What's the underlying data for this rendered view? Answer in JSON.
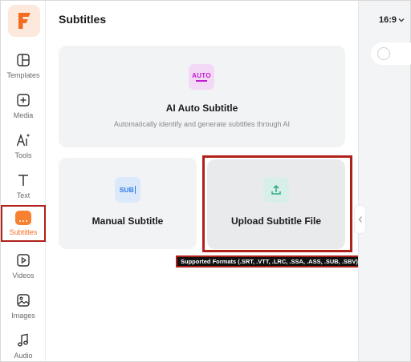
{
  "panel": {
    "title": "Subtitles"
  },
  "brand": {
    "logo_letter": "F",
    "accent_color": "#f26d21"
  },
  "nav": {
    "items": [
      {
        "label": "Templates",
        "icon": "templates-icon"
      },
      {
        "label": "Media",
        "icon": "media-plus-icon"
      },
      {
        "label": "Tools",
        "icon": "ai-tools-icon"
      },
      {
        "label": "Text",
        "icon": "text-icon"
      },
      {
        "label": "Subtitles",
        "icon": "subtitles-icon",
        "active": true
      },
      {
        "label": "Videos",
        "icon": "video-play-icon"
      },
      {
        "label": "Images",
        "icon": "image-icon"
      },
      {
        "label": "Audio",
        "icon": "music-note-icon"
      }
    ]
  },
  "cards": {
    "ai": {
      "icon_text": "AUTO",
      "title": "AI Auto Subtitle",
      "description": "Automatically identify and generate subtitles through AI"
    },
    "manual": {
      "icon_text": "SUB",
      "title": "Manual Subtitle"
    },
    "upload": {
      "title": "Upload Subtitle File"
    }
  },
  "tooltip": {
    "text": "Supported Formats  (.SRT, .VTT, .LRC, .SSA, .ASS, .SUB, .SBV)"
  },
  "preview": {
    "aspect_ratio": "16:9"
  },
  "colors": {
    "highlight_border": "#b0211a",
    "ai_icon_bg": "#f3d9f6",
    "ai_icon_fg": "#c21bd1",
    "sub_icon_bg": "#dbe9fb",
    "sub_icon_fg": "#2f7ae5",
    "upload_icon_bg": "#d8efe9",
    "upload_icon_fg": "#2aa88a"
  }
}
